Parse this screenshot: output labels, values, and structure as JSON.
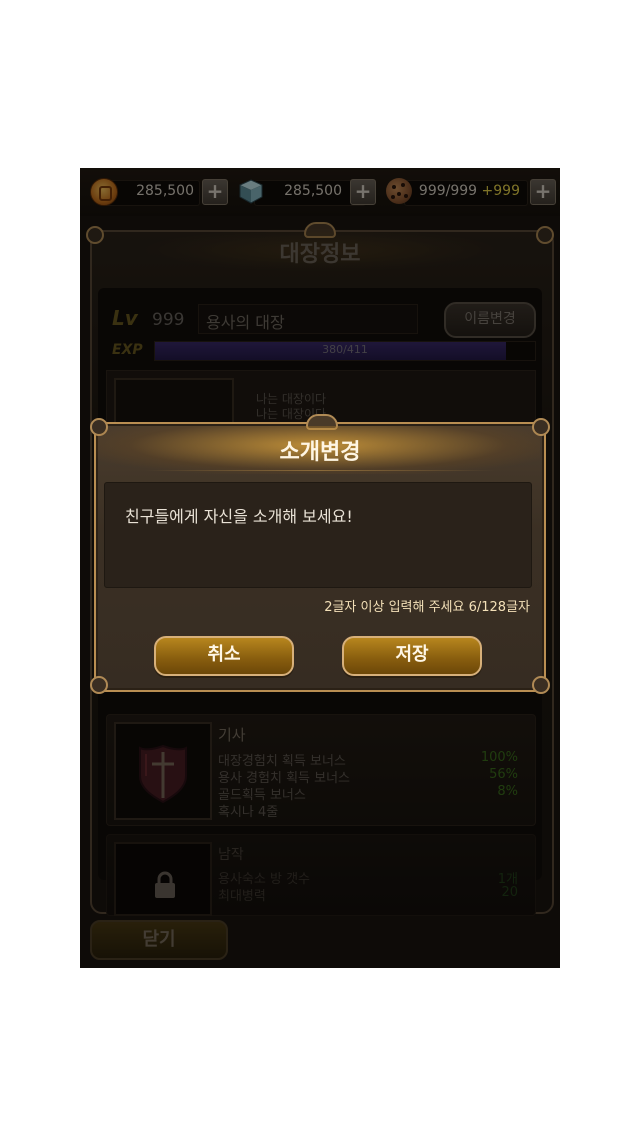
{
  "resources": {
    "gold": {
      "value": "285,500",
      "icon": "gold-coin-icon"
    },
    "crystal": {
      "value": "285,500",
      "icon": "crystal-cube-icon"
    },
    "cookie": {
      "value": "999/999",
      "bonus": "+999",
      "icon": "cookie-icon"
    },
    "plus_label": "+"
  },
  "captain": {
    "panel_title": "대장정보",
    "lv_label": "Lv",
    "level": "999",
    "name": "용사의 대장",
    "rename_button": "이름변경",
    "exp_label": "EXP",
    "exp_text": "380/411",
    "exp_fraction": 0.924,
    "intro_lines": [
      "나는 대장이다",
      "나는 대장이다"
    ]
  },
  "class_card": {
    "title": "기사",
    "rows": [
      {
        "label": "대장경험치 획득 보너스",
        "value": "100%"
      },
      {
        "label": "용사 경험치 획득 보너스",
        "value": "56%"
      },
      {
        "label": "골드획득 보너스",
        "value": "8%"
      },
      {
        "label": "혹시나 4줄",
        "value": ""
      }
    ]
  },
  "locked_card": {
    "title": "남작",
    "rows": [
      {
        "label": "용사숙소 방 갯수",
        "value": "1개"
      },
      {
        "label": "최대병력",
        "value": "20"
      }
    ]
  },
  "close_button": "닫기",
  "dialog": {
    "title": "소개변경",
    "input_value": "친구들에게 자신을 소개해 보세요!",
    "hint": "2글자 이상 입력해 주세요 6/128글자",
    "cancel_button": "취소",
    "save_button": "저장"
  }
}
